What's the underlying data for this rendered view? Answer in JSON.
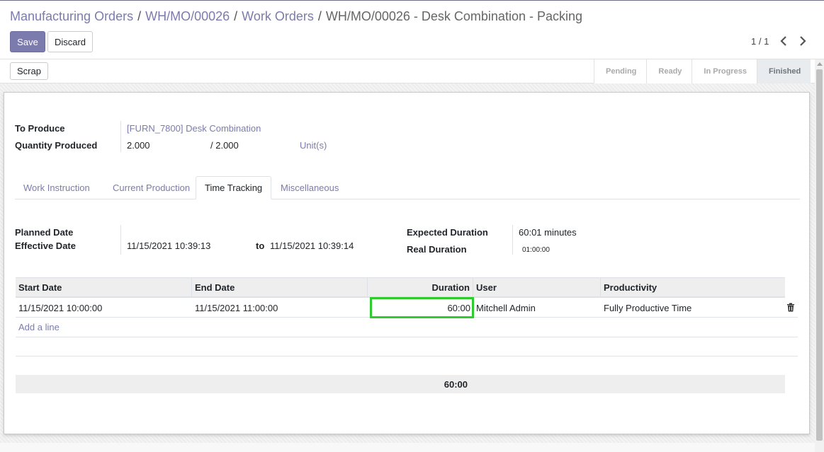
{
  "breadcrumb": {
    "items": [
      "Manufacturing Orders",
      "WH/MO/00026",
      "Work Orders"
    ],
    "separator": "/",
    "current": "WH/MO/00026 - Desk Combination - Packing"
  },
  "buttons": {
    "save": "Save",
    "discard": "Discard",
    "scrap": "Scrap"
  },
  "pager": {
    "value": "1 / 1"
  },
  "stages": [
    "Pending",
    "Ready",
    "In Progress",
    "Finished"
  ],
  "active_stage": "Finished",
  "form": {
    "to_produce_label": "To Produce",
    "to_produce_value": "[FURN_7800] Desk Combination",
    "qty_produced_label": "Quantity Produced",
    "qty_produced": "2.000",
    "qty_total": "/ 2.000",
    "uom": "Unit(s)"
  },
  "tabs": [
    "Work Instruction",
    "Current Production",
    "Time Tracking",
    "Miscellaneous"
  ],
  "active_tab": "Time Tracking",
  "time_tracking": {
    "planned_date_label": "Planned Date",
    "effective_date_label": "Effective Date",
    "effective_start": "11/15/2021 10:39:13",
    "to_label": "to",
    "effective_end": "11/15/2021 10:39:14",
    "expected_duration_label": "Expected Duration",
    "expected_duration": "60:01 minutes",
    "real_duration_label": "Real Duration",
    "real_duration": "01:00:00"
  },
  "table": {
    "columns": [
      "Start Date",
      "End Date",
      "Duration",
      "User",
      "Productivity"
    ],
    "rows": [
      {
        "start": "11/15/2021 10:00:00",
        "end": "11/15/2021 11:00:00",
        "duration": "60:00",
        "user": "Mitchell Admin",
        "productivity": "Fully Productive Time"
      }
    ],
    "add_line": "Add a line",
    "total_duration": "60:00"
  },
  "colors": {
    "accent": "#7c7bad",
    "highlight": "#2ecc2e"
  }
}
